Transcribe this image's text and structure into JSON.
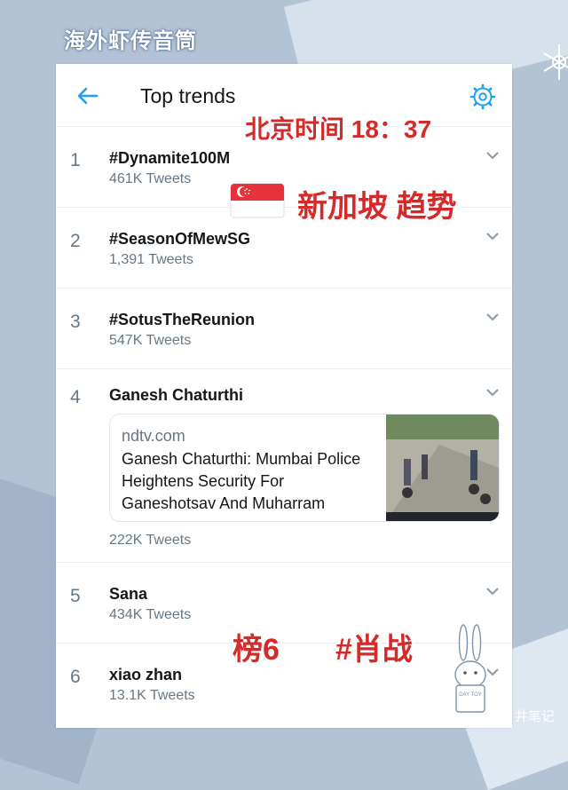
{
  "brand_text": "海外虾传音筒",
  "header": {
    "title": "Top trends",
    "back_icon": "arrow-left-icon",
    "settings_icon": "gear-icon"
  },
  "accent_color": "#1da1f2",
  "overlay_color": "#d42a2a",
  "trends": [
    {
      "rank": "1",
      "name": "#Dynamite100M",
      "count": "461K Tweets"
    },
    {
      "rank": "2",
      "name": "#SeasonOfMewSG",
      "count": "1,391 Tweets"
    },
    {
      "rank": "3",
      "name": "#SotusTheReunion",
      "count": "547K Tweets"
    },
    {
      "rank": "4",
      "name": "Ganesh Chaturthi",
      "count": "222K Tweets",
      "news": {
        "source": "ndtv.com",
        "headline": "Ganesh Chaturthi: Mumbai Police Heightens Security For Ganeshotsav And Muharram"
      }
    },
    {
      "rank": "5",
      "name": "Sana",
      "count": "434K Tweets"
    },
    {
      "rank": "6",
      "name": "xiao zhan",
      "count": "13.1K Tweets"
    }
  ],
  "overlays": {
    "time_label": "北京时间 18：37",
    "region_label": "新加坡 趋势",
    "rank_note": "榜6",
    "hashtag_note": "#肖战"
  },
  "watermark": "井笔记",
  "sticker_text": "DAY TOY"
}
